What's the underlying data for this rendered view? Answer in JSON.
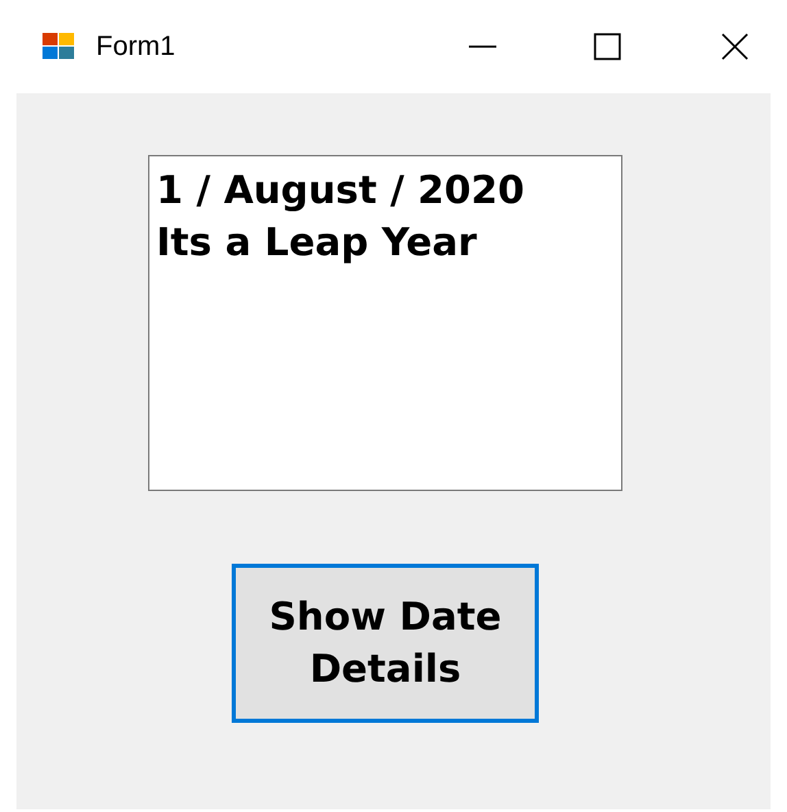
{
  "window": {
    "title": "Form1"
  },
  "text_box": {
    "lines": [
      "1 / August / 2020",
      "Its a Leap Year"
    ]
  },
  "button": {
    "label": "Show Date Details",
    "focused": true
  }
}
